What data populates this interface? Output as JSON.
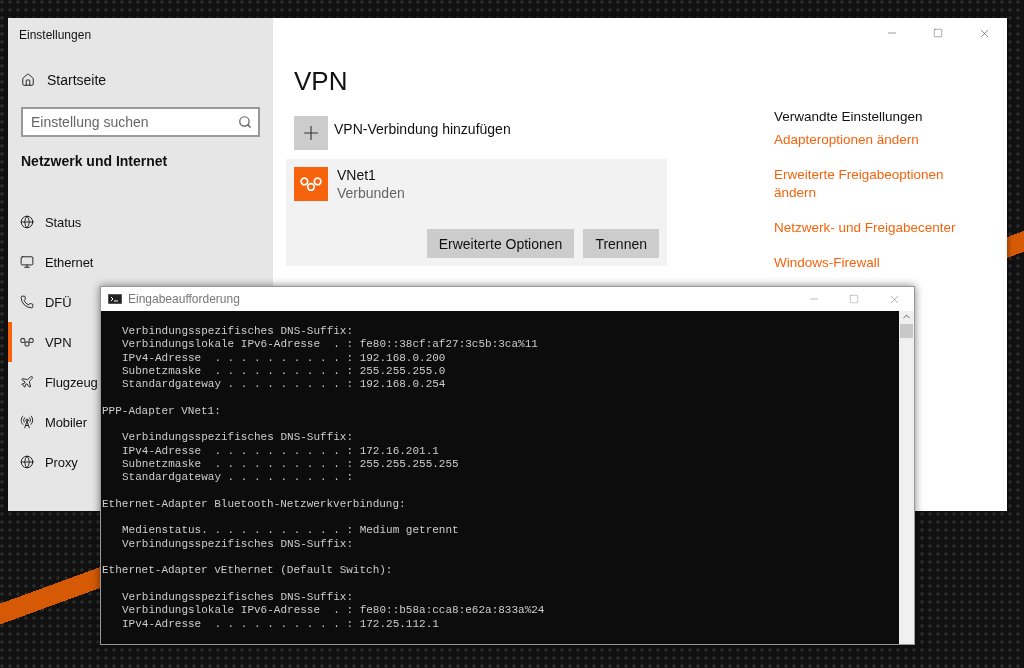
{
  "settings_window": {
    "title": "Einstellungen",
    "home": "Startseite",
    "search": {
      "placeholder": "Einstellung suchen"
    },
    "section": "Netzwerk und Internet",
    "sidebar": {
      "items": [
        {
          "label": "Status",
          "selected": false
        },
        {
          "label": "Ethernet",
          "selected": false
        },
        {
          "label": "DFÜ",
          "selected": false
        },
        {
          "label": "VPN",
          "selected": true
        },
        {
          "label": "Flugzeug",
          "selected": false
        },
        {
          "label": "Mobiler",
          "selected": false
        },
        {
          "label": "Proxy",
          "selected": false
        }
      ]
    },
    "page_title": "VPN",
    "add_connection": "VPN-Verbindung hinzufügen",
    "connection": {
      "name": "VNet1",
      "status": "Verbunden",
      "buttons": [
        "Erweiterte Optionen",
        "Trennen"
      ]
    },
    "related": {
      "title": "Verwandte Einstellungen",
      "links": [
        "Adapteroptionen ändern",
        "Erweiterte Freigabeoptionen ändern",
        "Netzwerk- und Freigabecenter",
        "Windows-Firewall"
      ]
    }
  },
  "console_window": {
    "title": "Eingabeaufforderung",
    "blocks": [
      {
        "lines": [
          {
            "kind": "entry",
            "text": "Verbindungsspezifisches DNS-Suffix:"
          },
          {
            "kind": "entry",
            "text": "Verbindungslokale IPv6-Adresse  . : fe80::38cf:af27:3c5b:3ca%11"
          },
          {
            "kind": "entry",
            "text": "IPv4-Adresse  . . . . . . . . . . : 192.168.0.200"
          },
          {
            "kind": "entry",
            "text": "Subnetzmaske  . . . . . . . . . . : 255.255.255.0"
          },
          {
            "kind": "entry",
            "text": "Standardgateway . . . . . . . . . : 192.168.0.254"
          }
        ]
      },
      {
        "lines": [
          {
            "kind": "header",
            "text": "PPP-Adapter VNet1:"
          }
        ]
      },
      {
        "lines": [
          {
            "kind": "entry",
            "text": "Verbindungsspezifisches DNS-Suffix:"
          },
          {
            "kind": "entry",
            "text": "IPv4-Adresse  . . . . . . . . . . : 172.16.201.1"
          },
          {
            "kind": "entry",
            "text": "Subnetzmaske  . . . . . . . . . . : 255.255.255.255"
          },
          {
            "kind": "entry",
            "text": "Standardgateway . . . . . . . . . :"
          }
        ]
      },
      {
        "lines": [
          {
            "kind": "header",
            "text": "Ethernet-Adapter Bluetooth-Netzwerkverbindung:"
          }
        ]
      },
      {
        "lines": [
          {
            "kind": "entry",
            "text": "Medienstatus. . . . . . . . . . . : Medium getrennt"
          },
          {
            "kind": "entry",
            "text": "Verbindungsspezifisches DNS-Suffix:"
          }
        ]
      },
      {
        "lines": [
          {
            "kind": "header",
            "text": "Ethernet-Adapter vEthernet (Default Switch):"
          }
        ]
      },
      {
        "lines": [
          {
            "kind": "entry",
            "text": "Verbindungsspezifisches DNS-Suffix:"
          },
          {
            "kind": "entry",
            "text": "Verbindungslokale IPv6-Adresse  . : fe80::b58a:cca8:e62a:833a%24"
          },
          {
            "kind": "entry",
            "text": "IPv4-Adresse  . . . . . . . . . . : 172.25.112.1"
          }
        ]
      }
    ]
  }
}
